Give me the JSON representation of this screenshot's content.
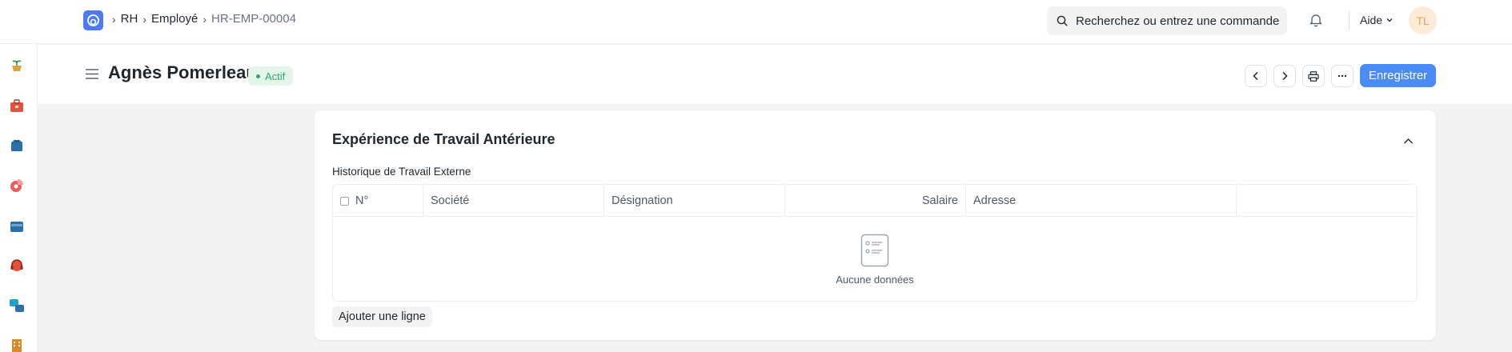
{
  "navbar": {
    "breadcrumbs": [
      "RH",
      "Employé",
      "HR-EMP-00004"
    ],
    "search_placeholder": "Recherchez ou entrez une commande",
    "help_label": "Aide",
    "avatar_initials": "TL"
  },
  "sidebar": {
    "icons": [
      {
        "name": "plant-pot-icon",
        "color": "#d9a441"
      },
      {
        "name": "toolbox-icon",
        "color": "#e0533d"
      },
      {
        "name": "shirt-icon",
        "color": "#2e6fa8"
      },
      {
        "name": "pie-chart-icon",
        "color": "#e85d5d"
      },
      {
        "name": "wallet-icon",
        "color": "#2e6fa8"
      },
      {
        "name": "headset-icon",
        "color": "#e0533d"
      },
      {
        "name": "shapes-icon",
        "color": "#1fa2c8"
      },
      {
        "name": "building-icon",
        "color": "#d98a2b"
      }
    ]
  },
  "page": {
    "title": "Agnès Pomerleau",
    "status": "Actif",
    "save_label": "Enregistrer"
  },
  "section": {
    "title": "Expérience de Travail Antérieure",
    "field_label": "Historique de Travail Externe",
    "columns": [
      "N°",
      "Société",
      "Désignation",
      "Salaire",
      "Adresse",
      ""
    ],
    "empty_text": "Aucune données",
    "add_row_label": "Ajouter une ligne"
  },
  "colors": {
    "primary": "#4b8bf4",
    "status_green": "#30a66d",
    "status_bg": "#e4f5e9"
  }
}
